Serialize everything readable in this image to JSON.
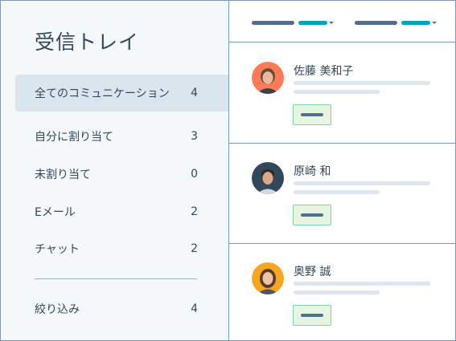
{
  "sidebar": {
    "title": "受信トレイ",
    "items": [
      {
        "label": "全てのコミュニケーション",
        "count": "4",
        "active": true
      },
      {
        "label": "自分に割り当て",
        "count": "3"
      },
      {
        "label": "未割り当て",
        "count": "0"
      },
      {
        "label": "Eメール",
        "count": "2"
      },
      {
        "label": "チャット",
        "count": "2"
      }
    ],
    "footer_item": {
      "label": "絞り込み",
      "count": "4"
    }
  },
  "conversations": [
    {
      "name": "佐藤 美和子",
      "avatar_bg": "#ff7a59"
    },
    {
      "name": "原崎 和",
      "avatar_bg": "#33475b"
    },
    {
      "name": "奥野 誠",
      "avatar_bg": "#f5a623"
    }
  ],
  "colors": {
    "accent": "#00a4bd",
    "border": "#7c98b6",
    "chip_bg": "#e5f5e0",
    "chip_border": "#7fd1a8",
    "sidebar_bg": "#f5f8fa",
    "active_bg": "#dbe5ee"
  }
}
